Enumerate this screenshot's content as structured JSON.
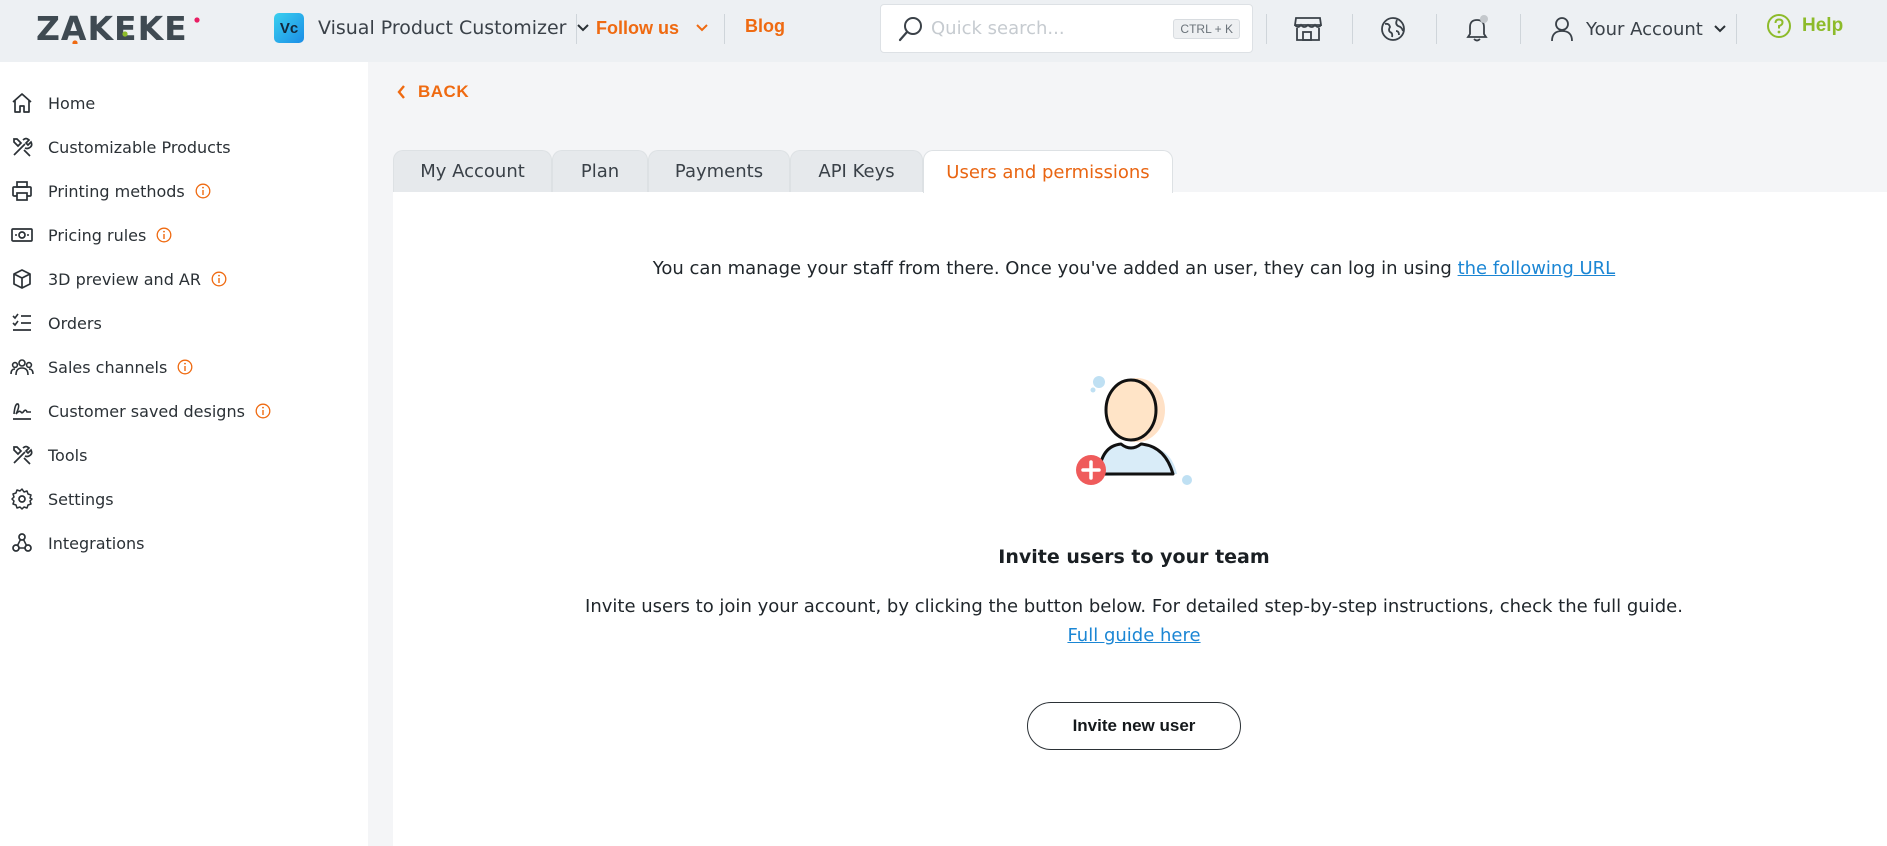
{
  "header": {
    "logo": "ZAKEKE",
    "app_badge": "Vc",
    "app_name": "Visual Product Customizer",
    "follow_label": "Follow us",
    "blog_label": "Blog",
    "search_placeholder": "Quick search...",
    "search_shortcut": "CTRL + K",
    "account_label": "Your Account",
    "help_label": "Help"
  },
  "sidebar": {
    "items": [
      {
        "label": "Home",
        "icon": "home-icon",
        "info": false
      },
      {
        "label": "Customizable Products",
        "icon": "tools-icon",
        "info": false
      },
      {
        "label": "Printing methods",
        "icon": "printer-icon",
        "info": true
      },
      {
        "label": "Pricing rules",
        "icon": "money-icon",
        "info": true
      },
      {
        "label": "3D preview and AR",
        "icon": "cube-icon",
        "info": true
      },
      {
        "label": "Orders",
        "icon": "list-check-icon",
        "info": false
      },
      {
        "label": "Sales channels",
        "icon": "group-icon",
        "info": true
      },
      {
        "label": "Customer saved designs",
        "icon": "signature-icon",
        "info": true
      },
      {
        "label": "Tools",
        "icon": "tools-icon",
        "info": false
      },
      {
        "label": "Settings",
        "icon": "gear-icon",
        "info": false
      },
      {
        "label": "Integrations",
        "icon": "integrations-icon",
        "info": false
      }
    ]
  },
  "main": {
    "back_label": "BACK",
    "tabs": [
      {
        "label": "My Account",
        "active": false
      },
      {
        "label": "Plan",
        "active": false
      },
      {
        "label": "Payments",
        "active": false
      },
      {
        "label": "API Keys",
        "active": false
      },
      {
        "label": "Users and permissions",
        "active": true
      }
    ],
    "intro_text": "You can manage your staff from there. Once you've added an user, they can log in using ",
    "intro_link": "the following URL",
    "invite_title": "Invite users to your team",
    "invite_desc": "Invite users to join your account, by clicking the button below. For detailed step-by-step instructions, check the full guide.",
    "guide_link": "Full guide here",
    "invite_button": "Invite new user"
  },
  "colors": {
    "accent": "#ef6a11",
    "help": "#8dbb2a",
    "link": "#1b86d4"
  }
}
